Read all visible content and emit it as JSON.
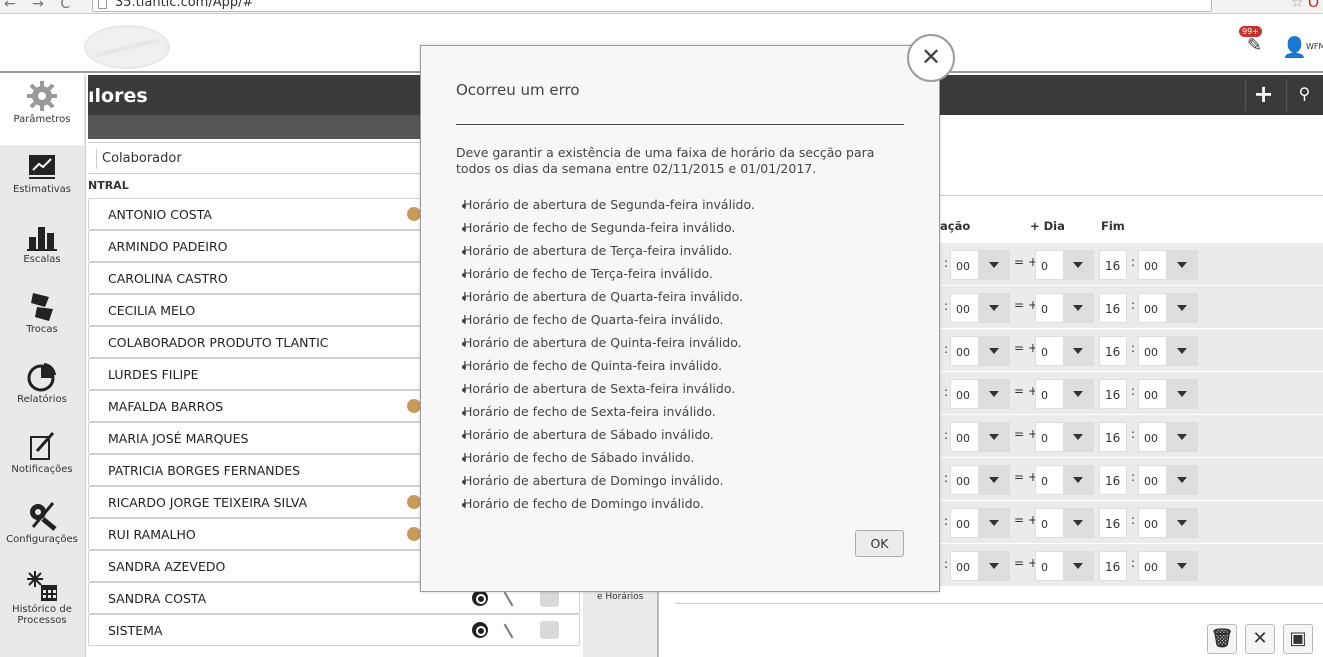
{
  "browser": {
    "url": "35.tlantic.com/App/#"
  },
  "header": {
    "notif_badge": "99+",
    "user_label": "WFM"
  },
  "sidebar": {
    "items": [
      {
        "label": "Parâmetros",
        "icon": "gear-icon"
      },
      {
        "label": "Estimativas",
        "icon": "trend-chart-icon"
      },
      {
        "label": "Escalas",
        "icon": "bar-chart-icon"
      },
      {
        "label": "Trocas",
        "icon": "swap-icon"
      },
      {
        "label": "Relatórios",
        "icon": "pie-chart-icon"
      },
      {
        "label": "Notificações",
        "icon": "notification-icon"
      },
      {
        "label": "Configurações",
        "icon": "tools-icon"
      },
      {
        "label": "Histórico de Processos",
        "icon": "history-calendar-icon"
      }
    ]
  },
  "panel": {
    "title": "ılores",
    "column_header": "Colaborador",
    "group": "NTRAL",
    "rows": [
      {
        "name": "ANTONIO COSTA"
      },
      {
        "name": "ARMINDO PADEIRO"
      },
      {
        "name": "CAROLINA CASTRO"
      },
      {
        "name": "CECILIA MELO"
      },
      {
        "name": "COLABORADOR PRODUTO TLANTIC"
      },
      {
        "name": "LURDES FILIPE"
      },
      {
        "name": "MAFALDA BARROS"
      },
      {
        "name": "MARIA JOSÉ MARQUES"
      },
      {
        "name": "PATRICIA BORGES FERNANDES"
      },
      {
        "name": "RICARDO JORGE TEIXEIRA SILVA"
      },
      {
        "name": "RUI RAMALHO"
      },
      {
        "name": "SANDRA AZEVEDO"
      },
      {
        "name": "SANDRA COSTA"
      },
      {
        "name": "SISTEMA"
      }
    ]
  },
  "middle": {
    "label": "e Horários"
  },
  "schedule": {
    "headers": {
      "duracao": "ação",
      "dia": "+ Dia",
      "fim": "Fim"
    },
    "rows": [
      {
        "min": "00",
        "dia": "0",
        "fim_h": "16",
        "fim_m": "00"
      },
      {
        "min": "00",
        "dia": "0",
        "fim_h": "16",
        "fim_m": "00"
      },
      {
        "min": "00",
        "dia": "0",
        "fim_h": "16",
        "fim_m": "00"
      },
      {
        "min": "00",
        "dia": "0",
        "fim_h": "16",
        "fim_m": "00"
      },
      {
        "min": "00",
        "dia": "0",
        "fim_h": "16",
        "fim_m": "00"
      },
      {
        "min": "00",
        "dia": "0",
        "fim_h": "16",
        "fim_m": "00"
      },
      {
        "min": "00",
        "dia": "0",
        "fim_h": "16",
        "fim_m": "00"
      },
      {
        "min": "00",
        "dia": "0",
        "fim_h": "16",
        "fim_m": "00"
      }
    ]
  },
  "modal": {
    "title": "Ocorreu um erro",
    "message": "Deve garantir a existência de uma faixa de horário da secção para todos os dias da semana entre 02/11/2015 e 01/01/2017.",
    "errors": [
      "Horário de abertura de Segunda-feira inválido.",
      "Horário de fecho de Segunda-feira inválido.",
      "Horário de abertura de Terça-feira inválido.",
      "Horário de fecho de Terça-feira inválido.",
      "Horário de abertura de Quarta-feira inválido.",
      "Horário de fecho de Quarta-feira inválido.",
      "Horário de abertura de Quinta-feira inválido.",
      "Horário de fecho de Quinta-feira inválido.",
      "Horário de abertura de Sexta-feira inválido.",
      "Horário de fecho de Sexta-feira inválido.",
      "Horário de abertura de Sábado inválido.",
      "Horário de fecho de Sábado inválido.",
      "Horário de abertura de Domingo inválido.",
      "Horário de fecho de Domingo inválido."
    ],
    "ok_label": "OK"
  }
}
